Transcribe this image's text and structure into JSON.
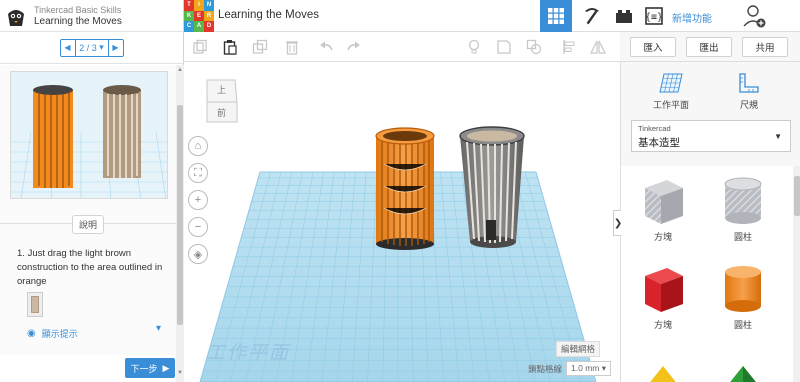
{
  "lesson": {
    "course": "Tinkercad Basic Skills",
    "title": "Learning the Moves",
    "pager": "2 / 3",
    "section_label": "說明",
    "instruction_number": "1.",
    "instruction_text": "Just drag the light brown construction to the area outlined in orange",
    "hint_label": "顯示提示",
    "next_label": "下一步"
  },
  "topbar": {
    "logo_letters": [
      "TIN",
      "KER",
      "CAD"
    ],
    "project_title": "Learning the Moves",
    "new_features": "新增功能"
  },
  "actions": {
    "import": "匯入",
    "export": "匯出",
    "share": "共用"
  },
  "canvas": {
    "viewcube_top": "上",
    "viewcube_front": "前",
    "workplane_label": "工作平面",
    "edit_grid": "編輯網格",
    "snap_grid_label": "鎖點格線",
    "snap_grid_value": "1.0 mm"
  },
  "right_panel": {
    "workplane_tool": "工作平面",
    "ruler_tool": "尺規",
    "library_source": "Tinkercad",
    "library_name": "基本造型",
    "shapes": [
      "方塊",
      "圓柱",
      "方塊",
      "圓柱"
    ]
  },
  "colors": {
    "accent": "#3a8ed8",
    "orange": "#f28a1e",
    "red": "#d8232a",
    "grid": "#a9d7ee"
  }
}
